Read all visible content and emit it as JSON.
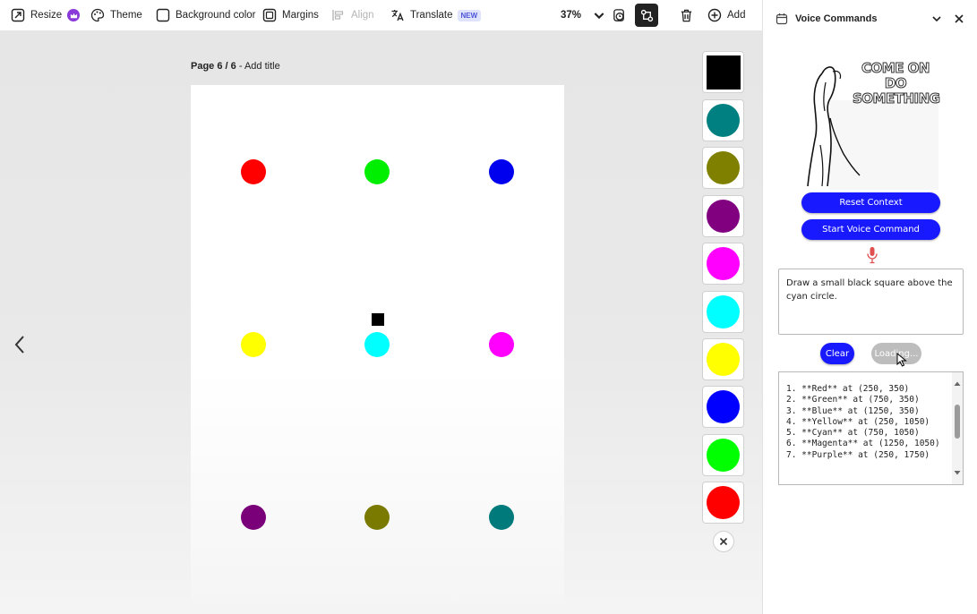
{
  "toolbar": {
    "resize": "Resize",
    "theme": "Theme",
    "background_color": "Background color",
    "margins": "Margins",
    "align": "Align",
    "translate": "Translate",
    "translate_badge": "NEW",
    "zoom": "37%",
    "add": "Add"
  },
  "page": {
    "number": "Page 6 / 6",
    "title_placeholder": "- Add title"
  },
  "shapes": {
    "dot_colors": [
      "#ff0000",
      "#00ee00",
      "#0000ee",
      "#ffff00",
      "#00ffff",
      "#ff00ff",
      "#7a007a",
      "#7a7a00",
      "#007a7a"
    ],
    "square_color": "#000000"
  },
  "swatches": [
    "#000000",
    "#008080",
    "#808000",
    "#800080",
    "#ff00ff",
    "#00ffff",
    "#ffff00",
    "#0000ff",
    "#00ff00",
    "#ff0000"
  ],
  "panel": {
    "title": "Voice Commands",
    "meme_text": "COME ON DO SOMETHING",
    "reset_button": "Reset Context",
    "voice_button": "Start Voice Command",
    "prompt_text": "Draw a small black square above the cyan circle.",
    "clear_button": "Clear",
    "loading_button": "Loading...",
    "output_text": "1. **Red** at (250, 350)\n2. **Green** at (750, 350)\n3. **Blue** at (1250, 350)\n4. **Yellow** at (250, 1050)\n5. **Cyan** at (750, 1050)\n6. **Magenta** at (1250, 1050)\n7. **Purple** at (250, 1750)"
  },
  "colors": {
    "accent_blue": "#1919ff",
    "mic_red": "#e05050"
  }
}
